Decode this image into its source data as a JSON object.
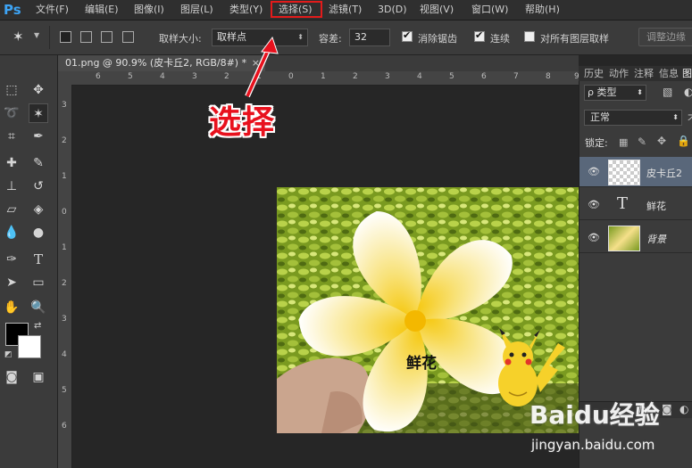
{
  "app": {
    "logo": "Ps"
  },
  "menu": [
    "文件(F)",
    "编辑(E)",
    "图像(I)",
    "图层(L)",
    "类型(Y)",
    "选择(S)",
    "滤镜(T)",
    "3D(D)",
    "视图(V)",
    "窗口(W)",
    "帮助(H)"
  ],
  "options": {
    "sample_size_label": "取样大小:",
    "sample_size_value": "取样点",
    "tolerance_label": "容差:",
    "tolerance_value": "32",
    "antialias_label": "消除锯齿",
    "contiguous_label": "连续",
    "all_layers_label": "对所有图层取样",
    "refine_edge_label": "调整边缘"
  },
  "document": {
    "tab_title": "01.png @ 90.9% (皮卡丘2, RGB/8#) *"
  },
  "ruler": {
    "top_ticks": [
      "6",
      "5",
      "4",
      "3",
      "2",
      "1",
      "0",
      "1",
      "2",
      "3",
      "4",
      "5",
      "6",
      "7",
      "8",
      "9"
    ],
    "left_ticks": [
      "3",
      "2",
      "1",
      "0",
      "1",
      "2",
      "3",
      "4",
      "5",
      "6"
    ]
  },
  "panels": {
    "tabs": [
      "历史",
      "动作",
      "注释",
      "信息",
      "图"
    ],
    "filter_kind": "类型",
    "blend_mode": "正常",
    "lock_label": "锁定:",
    "layers": [
      {
        "name": "皮卡丘2",
        "type": "smart"
      },
      {
        "name": "鲜花",
        "type": "text"
      },
      {
        "name": "背景",
        "type": "image"
      }
    ]
  },
  "canvas": {
    "text_layer": "鲜花"
  },
  "annotation": {
    "label": "选择",
    "color": "#e8111d"
  },
  "watermark": {
    "brand": "Baidu经验",
    "url": "jingyan.baidu.com"
  }
}
